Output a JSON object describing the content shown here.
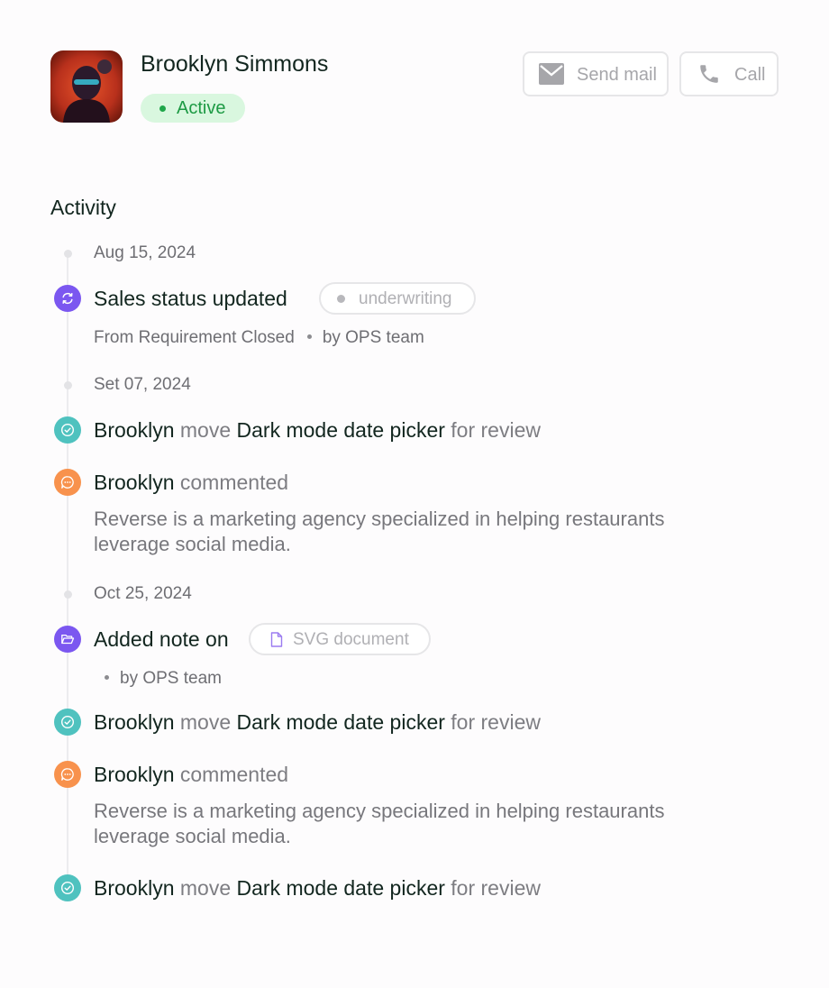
{
  "profile": {
    "name": "Brooklyn Simmons",
    "status": "Active"
  },
  "actions": {
    "send_mail": "Send mail",
    "call": "Call"
  },
  "activity": {
    "title": "Activity",
    "groups": [
      {
        "date": "Aug 15, 2024",
        "entries": [
          {
            "title": "Sales status updated",
            "tag": "underwriting",
            "from": "From Requirement Closed",
            "by": "by OPS team"
          }
        ]
      },
      {
        "date": "Set 07, 2024",
        "entries": [
          {
            "actor": "Brooklyn",
            "verb": "move",
            "item": "Dark mode date picker",
            "suffix": "for review"
          },
          {
            "actor": "Brooklyn",
            "verb": "commented",
            "body": "Reverse is a marketing agency specialized in helping restaurants leverage social media."
          }
        ]
      },
      {
        "date": "Oct 25, 2024",
        "entries": [
          {
            "title": "Added note on",
            "attachment": "SVG document",
            "by": "by OPS team"
          },
          {
            "actor": "Brooklyn",
            "verb": "move",
            "item": "Dark mode date picker",
            "suffix": "for review"
          },
          {
            "actor": "Brooklyn",
            "verb": "commented",
            "body": "Reverse is a marketing agency specialized in helping restaurants leverage social media."
          },
          {
            "actor": "Brooklyn",
            "verb": "move",
            "item": "Dark mode date picker",
            "suffix": "for review"
          }
        ]
      }
    ]
  },
  "colors": {
    "status_bg": "#d9f7df",
    "status_fg": "#1d9a44",
    "purple": "#7b57f0",
    "teal": "#4fc2bf",
    "orange": "#f8924d"
  },
  "icons": {
    "mail": "mail-icon",
    "phone": "phone-icon",
    "sync": "sync-icon",
    "check": "check-circle-icon",
    "comment": "comment-icon",
    "folder": "folder-open-icon",
    "file": "file-icon"
  }
}
